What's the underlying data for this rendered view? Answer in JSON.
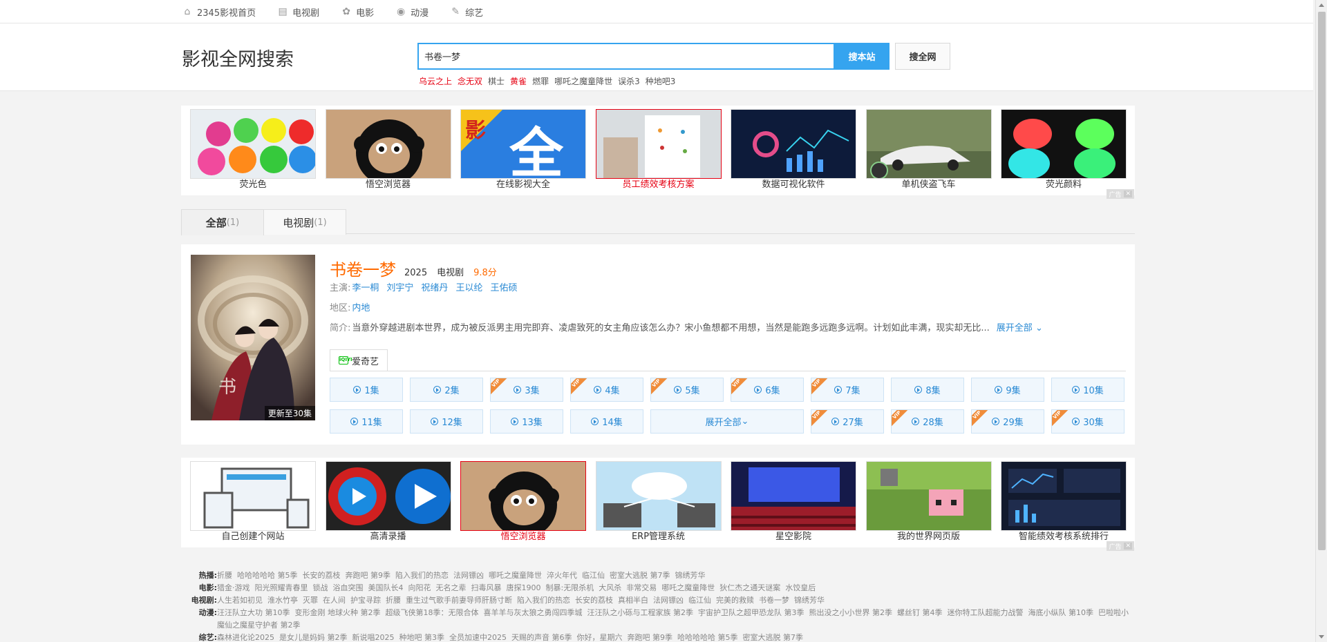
{
  "nav": [
    {
      "label": "2345影视首页",
      "icon": "home-icon"
    },
    {
      "label": "电视剧",
      "icon": "tv-icon"
    },
    {
      "label": "电影",
      "icon": "film-reel-icon"
    },
    {
      "label": "动漫",
      "icon": "bear-icon"
    },
    {
      "label": "综艺",
      "icon": "microphone-icon"
    }
  ],
  "header": {
    "title": "影视全网搜索",
    "query": "书卷一梦",
    "btn_site": "搜本站",
    "btn_all": "搜全网",
    "hot_words": [
      {
        "text": "乌云之上",
        "red": true
      },
      {
        "text": "念无双",
        "red": true
      },
      {
        "text": "棋士",
        "red": false
      },
      {
        "text": "黄雀",
        "red": true
      },
      {
        "text": "燃罪",
        "red": false
      },
      {
        "text": "哪吒之魔童降世",
        "red": false
      },
      {
        "text": "误杀3",
        "red": false
      },
      {
        "text": "种地吧3",
        "red": false
      }
    ]
  },
  "ads_top": [
    "荧光色",
    "悟空浏览器",
    "在线影视大全",
    "员工绩效考核方案",
    "数据可视化软件",
    "单机侠盗飞车",
    "荧光颜料"
  ],
  "ads_bottom": [
    "自己创建个网站",
    "高清录播",
    "悟空浏览器",
    "ERP管理系统",
    "星空影院",
    "我的世界网页版",
    "智能绩效考核系统排行"
  ],
  "ad_label": "广告",
  "tabs": [
    {
      "label": "全部",
      "count": "(1)"
    },
    {
      "label": "电视剧",
      "count": "(1)"
    }
  ],
  "result": {
    "title": "书卷一梦",
    "year": "2025",
    "type": "电视剧",
    "score": "9.8分",
    "update": "更新至30集",
    "cast_label": "主演:",
    "cast": [
      "李一桐",
      "刘宇宁",
      "祝绪丹",
      "王以纶",
      "王佑硕"
    ],
    "region_label": "地区:",
    "region": "内地",
    "intro_label": "简介:",
    "intro": "当意外穿越进剧本世界，成为被反派男主用完即弃、凌虐致死的女主角应该怎么办？宋小鱼想都不用想，当然是能跑多远跑多远啊。计划如此丰满，现实却无比...",
    "more": "展开全部",
    "source": "爱奇艺",
    "source_logo": "iQIYI",
    "vip_label": "VIP",
    "episodes_row1": [
      {
        "label": "1集",
        "vip": false
      },
      {
        "label": "2集",
        "vip": false
      },
      {
        "label": "3集",
        "vip": true
      },
      {
        "label": "4集",
        "vip": true
      },
      {
        "label": "5集",
        "vip": true
      },
      {
        "label": "6集",
        "vip": true
      },
      {
        "label": "7集",
        "vip": true
      },
      {
        "label": "8集",
        "vip": false
      },
      {
        "label": "9集",
        "vip": false
      },
      {
        "label": "10集",
        "vip": false
      }
    ],
    "episodes_row2": [
      {
        "label": "11集",
        "vip": false
      },
      {
        "label": "12集",
        "vip": false
      },
      {
        "label": "13集",
        "vip": false
      },
      {
        "label": "14集",
        "vip": false
      }
    ],
    "expand_label": "展开全部",
    "episodes_row2b": [
      {
        "label": "27集",
        "vip": true
      },
      {
        "label": "28集",
        "vip": true
      },
      {
        "label": "29集",
        "vip": true
      },
      {
        "label": "30集",
        "vip": true
      }
    ]
  },
  "hotlist": [
    {
      "label": "热播:",
      "items": [
        "折腰",
        "哈哈哈哈哈 第5季",
        "长安的荔枝",
        "奔跑吧 第9季",
        "陷入我们的热恋",
        "法网镖凶",
        "哪吒之魔童降世",
        "淬火年代",
        "临江仙",
        "密室大逃脱 第7季",
        "锦绣芳华"
      ]
    },
    {
      "label": "电影:",
      "items": [
        "猎金·游戏",
        "阳光照耀青春里",
        "锁战",
        "浴血突围",
        "美国队长4",
        "向阳花",
        "无名之辈",
        "扫毒风暴",
        "唐探1900",
        "制暴:无限杀机",
        "大风杀",
        "非常交易",
        "哪吒之魔童降世",
        "狄仁杰之通天谜案",
        "水饺皇后"
      ]
    },
    {
      "label": "电视剧:",
      "items": [
        "人生若如初见",
        "淮水竹亭",
        "灭罪",
        "在人间",
        "护宝寻踪",
        "折腰",
        "重生过气歌手前妻导师肝肠寸断",
        "陷入我们的热恋",
        "长安的荔枝",
        "真相半白",
        "法网镖凶",
        "临江仙",
        "完美的救赎",
        "书卷一梦",
        "锦绣芳华"
      ]
    },
    {
      "label": "动漫:",
      "items": [
        "汪汪队立大功 第10季",
        "变形金刚 地球火种 第2季",
        "超级飞侠第18季：无限合体",
        "喜羊羊与灰太狼之勇闯四季城",
        "汪汪队之小砾与工程家族 第2季",
        "宇宙护卫队之超甲恐龙队 第3季",
        "熊出没之小小世界 第2季",
        "螺丝钉 第4季",
        "迷你特工队超能力战警",
        "海底小纵队 第10季",
        "巴啦啦小魔仙之魔星守护者 第2季"
      ]
    },
    {
      "label": "综艺:",
      "items": [
        "森林进化论2025",
        "是女儿是妈妈 第2季",
        "新说唱2025",
        "种地吧 第3季",
        "全员加速中2025",
        "天赐的声音 第6季",
        "你好，星期六",
        "奔跑吧 第9季",
        "哈哈哈哈哈 第5季",
        "密室大逃脱 第7季"
      ]
    }
  ]
}
